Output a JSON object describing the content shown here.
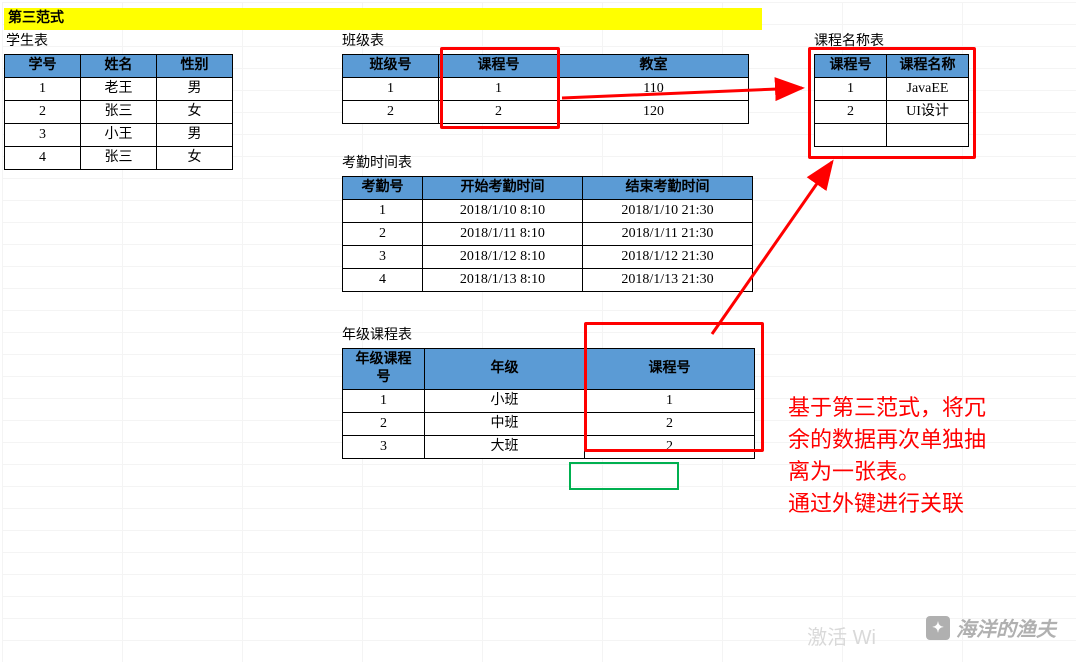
{
  "title_bar": "第三范式",
  "tables": {
    "student": {
      "caption": "学生表",
      "headers": [
        "学号",
        "姓名",
        "性别"
      ],
      "rows": [
        [
          "1",
          "老王",
          "男"
        ],
        [
          "2",
          "张三",
          "女"
        ],
        [
          "3",
          "小王",
          "男"
        ],
        [
          "4",
          "张三",
          "女"
        ]
      ]
    },
    "class": {
      "caption": "班级表",
      "headers": [
        "班级号",
        "课程号",
        "教室"
      ],
      "rows": [
        [
          "1",
          "1",
          "110"
        ],
        [
          "2",
          "2",
          "120"
        ]
      ]
    },
    "course": {
      "caption": "课程名称表",
      "headers": [
        "课程号",
        "课程名称"
      ],
      "rows": [
        [
          "1",
          "JavaEE"
        ],
        [
          "2",
          "UI设计"
        ]
      ]
    },
    "attendance": {
      "caption": "考勤时间表",
      "headers": [
        "考勤号",
        "开始考勤时间",
        "结束考勤时间"
      ],
      "rows": [
        [
          "1",
          "2018/1/10 8:10",
          "2018/1/10 21:30"
        ],
        [
          "2",
          "2018/1/11 8:10",
          "2018/1/11 21:30"
        ],
        [
          "3",
          "2018/1/12 8:10",
          "2018/1/12 21:30"
        ],
        [
          "4",
          "2018/1/13 8:10",
          "2018/1/13 21:30"
        ]
      ]
    },
    "gradecourse": {
      "caption": "年级课程表",
      "headers": [
        "年级课程号",
        "年级",
        "课程号"
      ],
      "rows": [
        [
          "1",
          "小班",
          "1"
        ],
        [
          "2",
          "中班",
          "2"
        ],
        [
          "3",
          "大班",
          "2"
        ]
      ]
    }
  },
  "annotation": {
    "line1": "基于第三范式，将冗",
    "line2": "余的数据再次单独抽",
    "line3": "离为一张表。",
    "line4": "通过外键进行关联"
  },
  "watermark": "海洋的渔夫",
  "faint_text": "激活 Wi"
}
